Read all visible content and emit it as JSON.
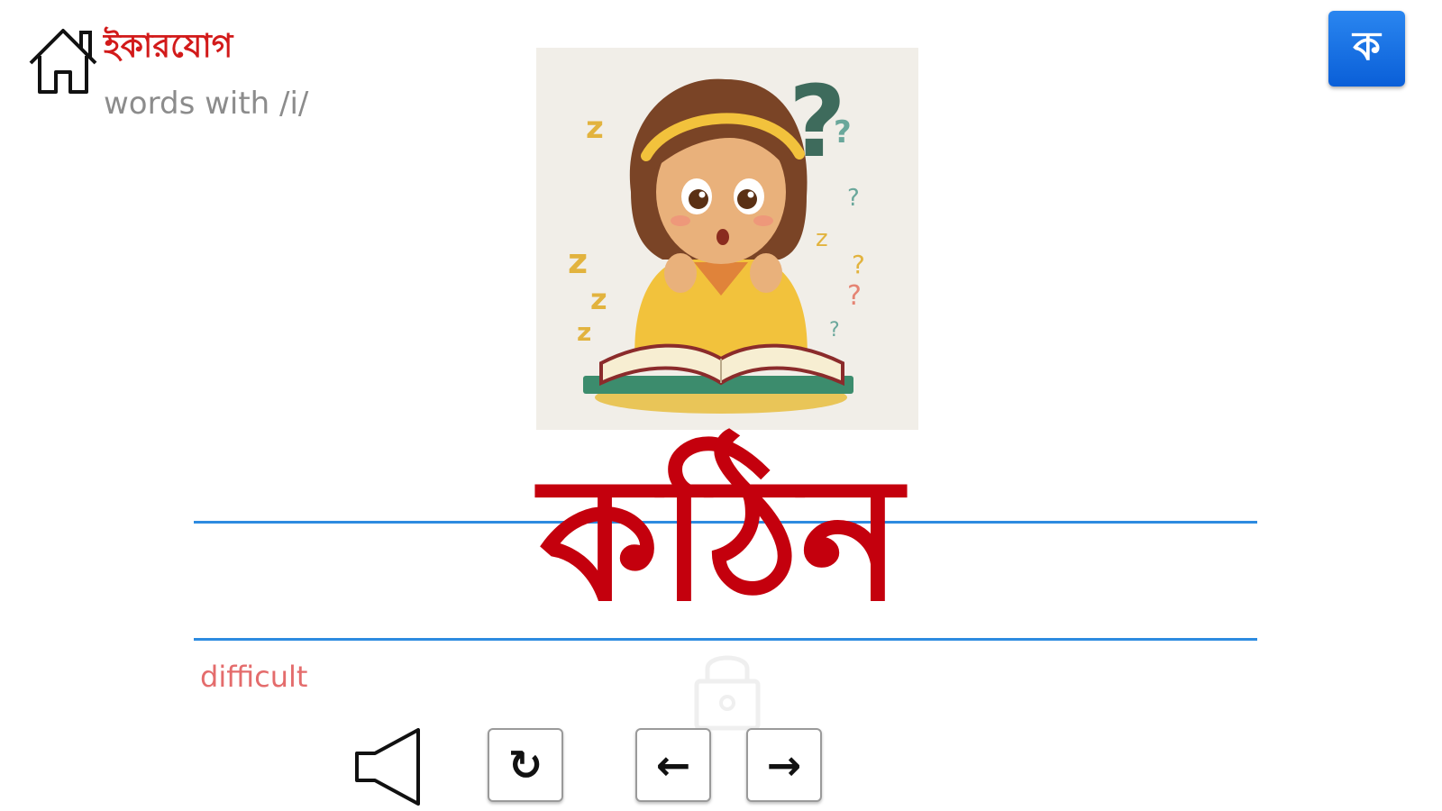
{
  "header": {
    "title_bn": "ইকারযোগ",
    "subtitle_en": "words with /i/",
    "home_icon": "home-icon"
  },
  "language_button": {
    "label": "ক"
  },
  "card": {
    "image_description_icon": "girl-reading-confused-illustration",
    "word": "কঠিন",
    "translation": "difficult"
  },
  "controls": {
    "speaker_icon": "speaker-icon",
    "replay_label": "↻",
    "prev_label": "←",
    "next_label": "→"
  },
  "colors": {
    "title_red": "#d21a1a",
    "word_red": "#c4000d",
    "guide_blue": "#2d8be0",
    "button_blue": "#0a5fd8",
    "translation_pink": "#e46c6c"
  }
}
